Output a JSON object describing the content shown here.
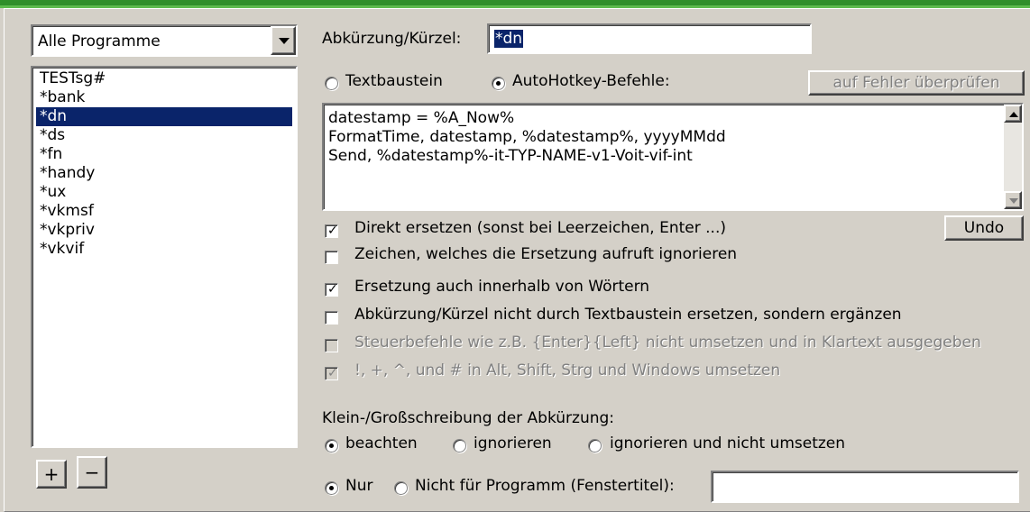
{
  "program_select": {
    "value": "Alle Programme"
  },
  "hotstrings": {
    "items": [
      "TESTsg#",
      "*bank",
      "*dn",
      "*ds",
      "*fn",
      "*handy",
      "*ux",
      "*vkmsf",
      "*vkpriv",
      "*vkvif"
    ],
    "selected_index": 2
  },
  "buttons": {
    "add_label": "+",
    "remove_label": "−",
    "check_label": "auf Fehler überprüfen",
    "undo_label": "Undo"
  },
  "abbreviation": {
    "label": "Abkürzung/Kürzel:",
    "value": "*dn"
  },
  "mode": {
    "textbaustein_label": "Textbaustein",
    "autohotkey_label": "AutoHotkey-Befehle:",
    "selected": "autohotkey"
  },
  "code_lines": [
    "datestamp = %A_Now%",
    "FormatTime, datestamp, %datestamp%, yyyyMMdd",
    "Send, %datestamp%-it-TYP-NAME-v1-Voit-vif-int"
  ],
  "options": {
    "direct_replace": {
      "label": "Direkt ersetzen (sonst bei Leerzeichen, Enter ...)",
      "checked": true,
      "enabled": true
    },
    "ignore_trigger_char": {
      "label": "Zeichen, welches die Ersetzung aufruft ignorieren",
      "checked": false,
      "enabled": true
    },
    "inside_words": {
      "label": "Ersetzung auch innerhalb von Wörtern",
      "checked": true,
      "enabled": true
    },
    "no_backspace": {
      "label": "Abkürzung/Kürzel nicht durch Textbaustein ersetzen, sondern ergänzen",
      "checked": false,
      "enabled": true
    },
    "raw_mode": {
      "label": "Steuerbefehle wie z.B. {Enter}{Left} nicht umsetzen und in Klartext ausgegeben",
      "checked": false,
      "enabled": false
    },
    "modifier_translate": {
      "label": "!, +, ^, und # in Alt, Shift, Strg und Windows umsetzen",
      "checked": true,
      "enabled": false
    }
  },
  "case": {
    "heading": "Klein-/Großschreibung der Abkürzung:",
    "observe_label": "beachten",
    "ignore_label": "ignorieren",
    "ignore_no_convert_label": "ignorieren und nicht umsetzen",
    "selected": "observe"
  },
  "program_filter": {
    "only_label": "Nur",
    "not_label": "Nicht für Programm (Fenstertitel):",
    "selected": "only",
    "value": ""
  }
}
